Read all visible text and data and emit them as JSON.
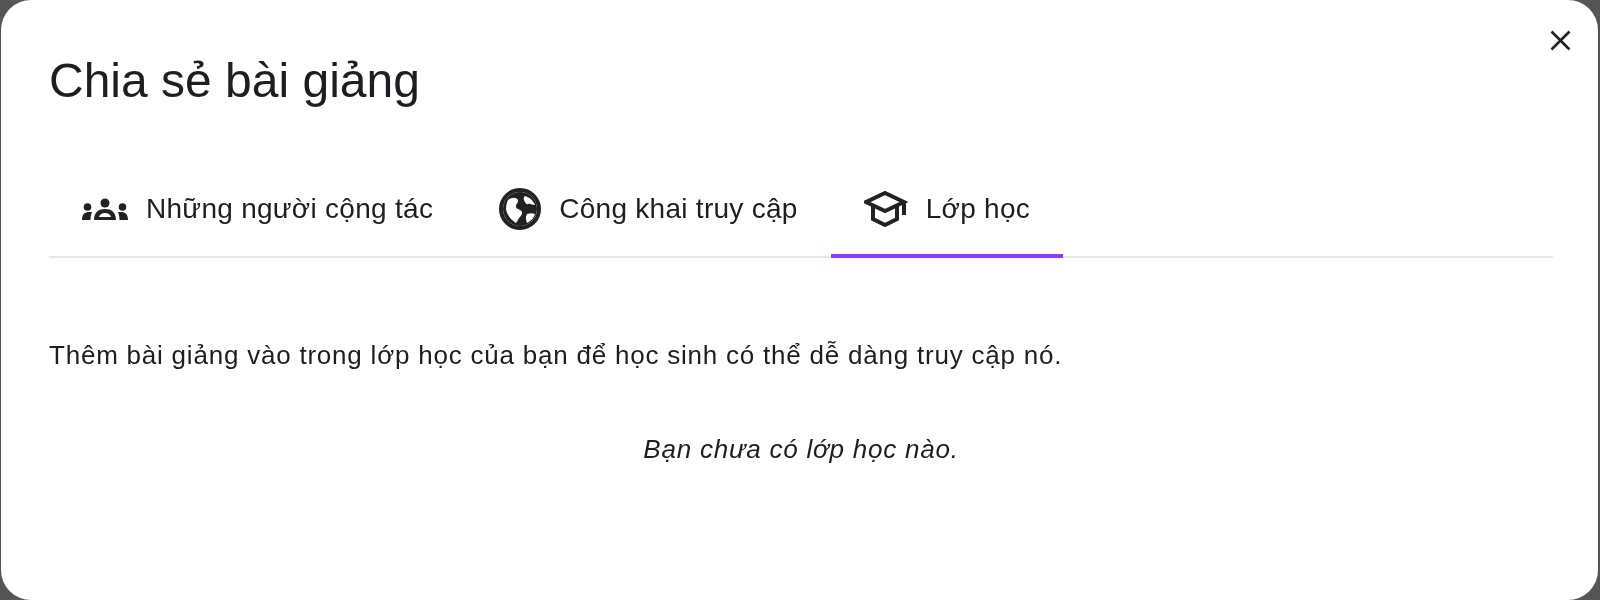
{
  "dialog": {
    "title": "Chia sẻ bài giảng"
  },
  "tabs": [
    {
      "label": "Những người cộng tác",
      "selected": false,
      "kind": "people"
    },
    {
      "label": "Công khai truy cập",
      "selected": false,
      "kind": "globe"
    },
    {
      "label": "Lớp học",
      "selected": true,
      "kind": "classroom"
    }
  ],
  "description": "Thêm bài giảng vào trong lớp học của bạn để học sinh có thể dễ dàng truy cập nó.",
  "empty_message": "Bạn chưa có lớp học nào."
}
